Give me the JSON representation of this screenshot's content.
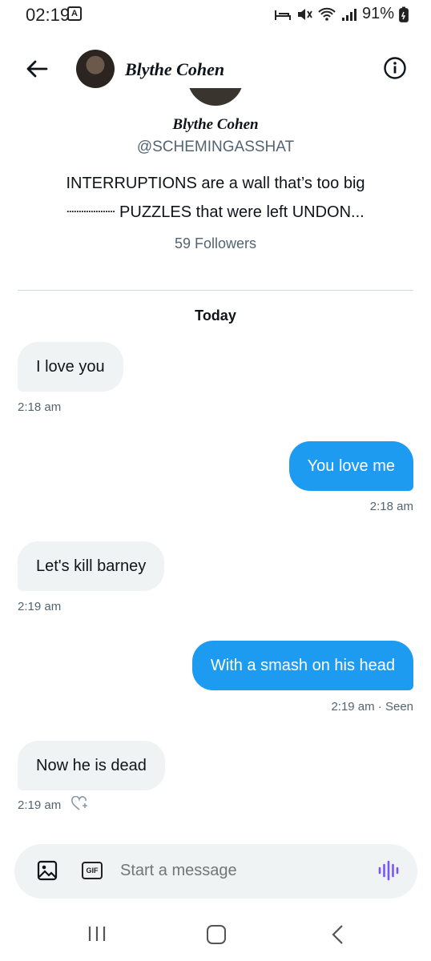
{
  "status": {
    "time": "02:19",
    "badge": "A",
    "battery": "91%"
  },
  "header": {
    "name": "Blythe Cohen"
  },
  "profile": {
    "name": "Blythe Cohen",
    "handle": "@SCHEMINGASSHAT",
    "bio_line1": "INTERRUPTIONS are a wall that’s too big",
    "bio_line2": "┈┈┈┈┈ PUZZLES that were left UNDON...",
    "followers": "59 Followers"
  },
  "chat": {
    "day_label": "Today",
    "messages": [
      {
        "text": "I love you",
        "time": "2:18 am"
      },
      {
        "text": "You love me",
        "time": "2:18 am"
      },
      {
        "text": "Let's kill barney",
        "time": "2:19 am"
      },
      {
        "text": "With a smash on his head",
        "time": "2:19 am · Seen"
      },
      {
        "text": "Now he is dead",
        "time": "2:19 am"
      }
    ]
  },
  "composer": {
    "gif_label": "GIF",
    "placeholder": "Start a message"
  },
  "colors": {
    "accent": "#1d9bf0",
    "bubble_received": "#eff3f4",
    "mic": "#7856ff"
  }
}
